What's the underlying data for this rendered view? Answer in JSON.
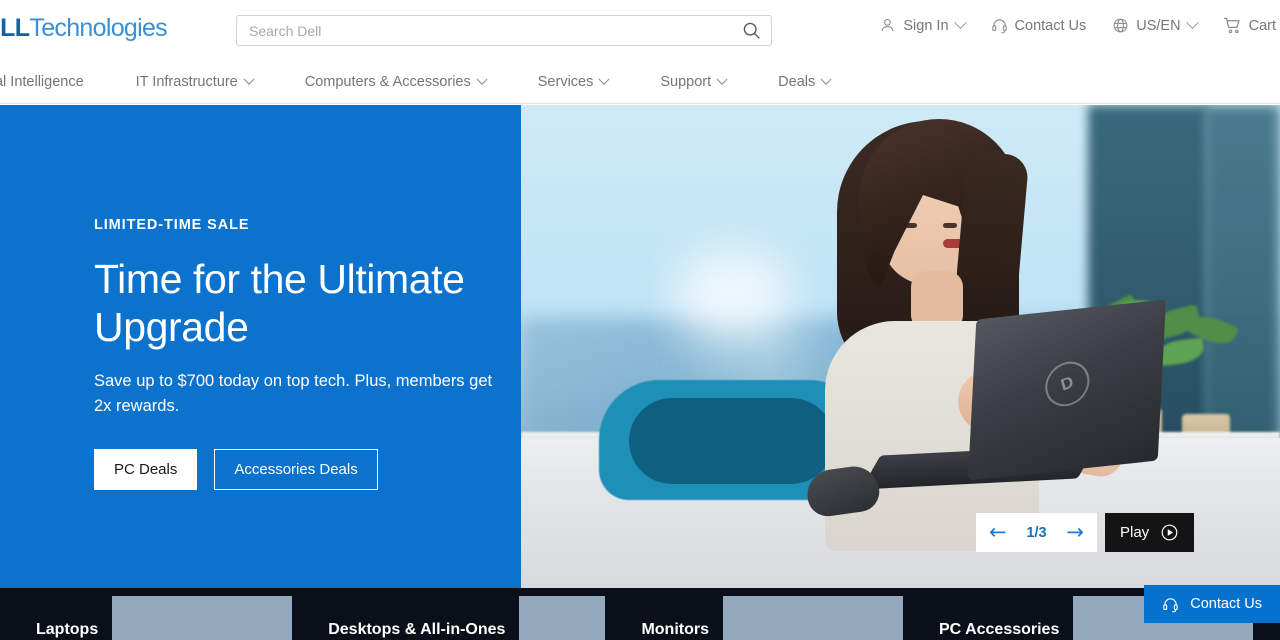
{
  "header": {
    "logo": {
      "mark": "∕",
      "brand": "ELL",
      "suffix": "Technologies"
    },
    "search": {
      "value": "",
      "placeholder": "Search Dell",
      "icon": "search-icon"
    },
    "account": {
      "label": "Sign In",
      "icon": "person-icon"
    },
    "contact": {
      "label": "Contact Us",
      "icon": "headset-icon"
    },
    "locale": {
      "label": "US/EN",
      "icon": "globe-icon"
    },
    "cart": {
      "label": "Cart",
      "icon": "cart-icon"
    }
  },
  "nav": {
    "items": [
      {
        "label": "tificial Intelligence",
        "has_chevron": false
      },
      {
        "label": "IT Infrastructure",
        "has_chevron": true
      },
      {
        "label": "Computers & Accessories",
        "has_chevron": true
      },
      {
        "label": "Services",
        "has_chevron": true
      },
      {
        "label": "Support",
        "has_chevron": true
      },
      {
        "label": "Deals",
        "has_chevron": true
      }
    ]
  },
  "hero": {
    "eyebrow": "LIMITED-TIME SALE",
    "title": "Time for the Ultimate Upgrade",
    "subtitle": "Save up to $700 today on top tech. Plus, members get 2x rewards.",
    "primary_cta": "PC Deals",
    "secondary_cta": "Accessories Deals",
    "background_color": "#0b73cd",
    "carousel": {
      "prev_icon": "arrow-left-icon",
      "next_icon": "arrow-right-icon",
      "counter": "1/3",
      "play_label": "Play",
      "play_icon": "play-circle-icon"
    }
  },
  "categories": {
    "items": [
      {
        "label": "Laptops"
      },
      {
        "label": "Desktops & All-in-Ones"
      },
      {
        "label": "Monitors"
      },
      {
        "label": "PC Accessories"
      }
    ]
  },
  "floating_contact": {
    "label": "Contact Us",
    "icon": "headset-icon",
    "color": "#0672ce"
  }
}
